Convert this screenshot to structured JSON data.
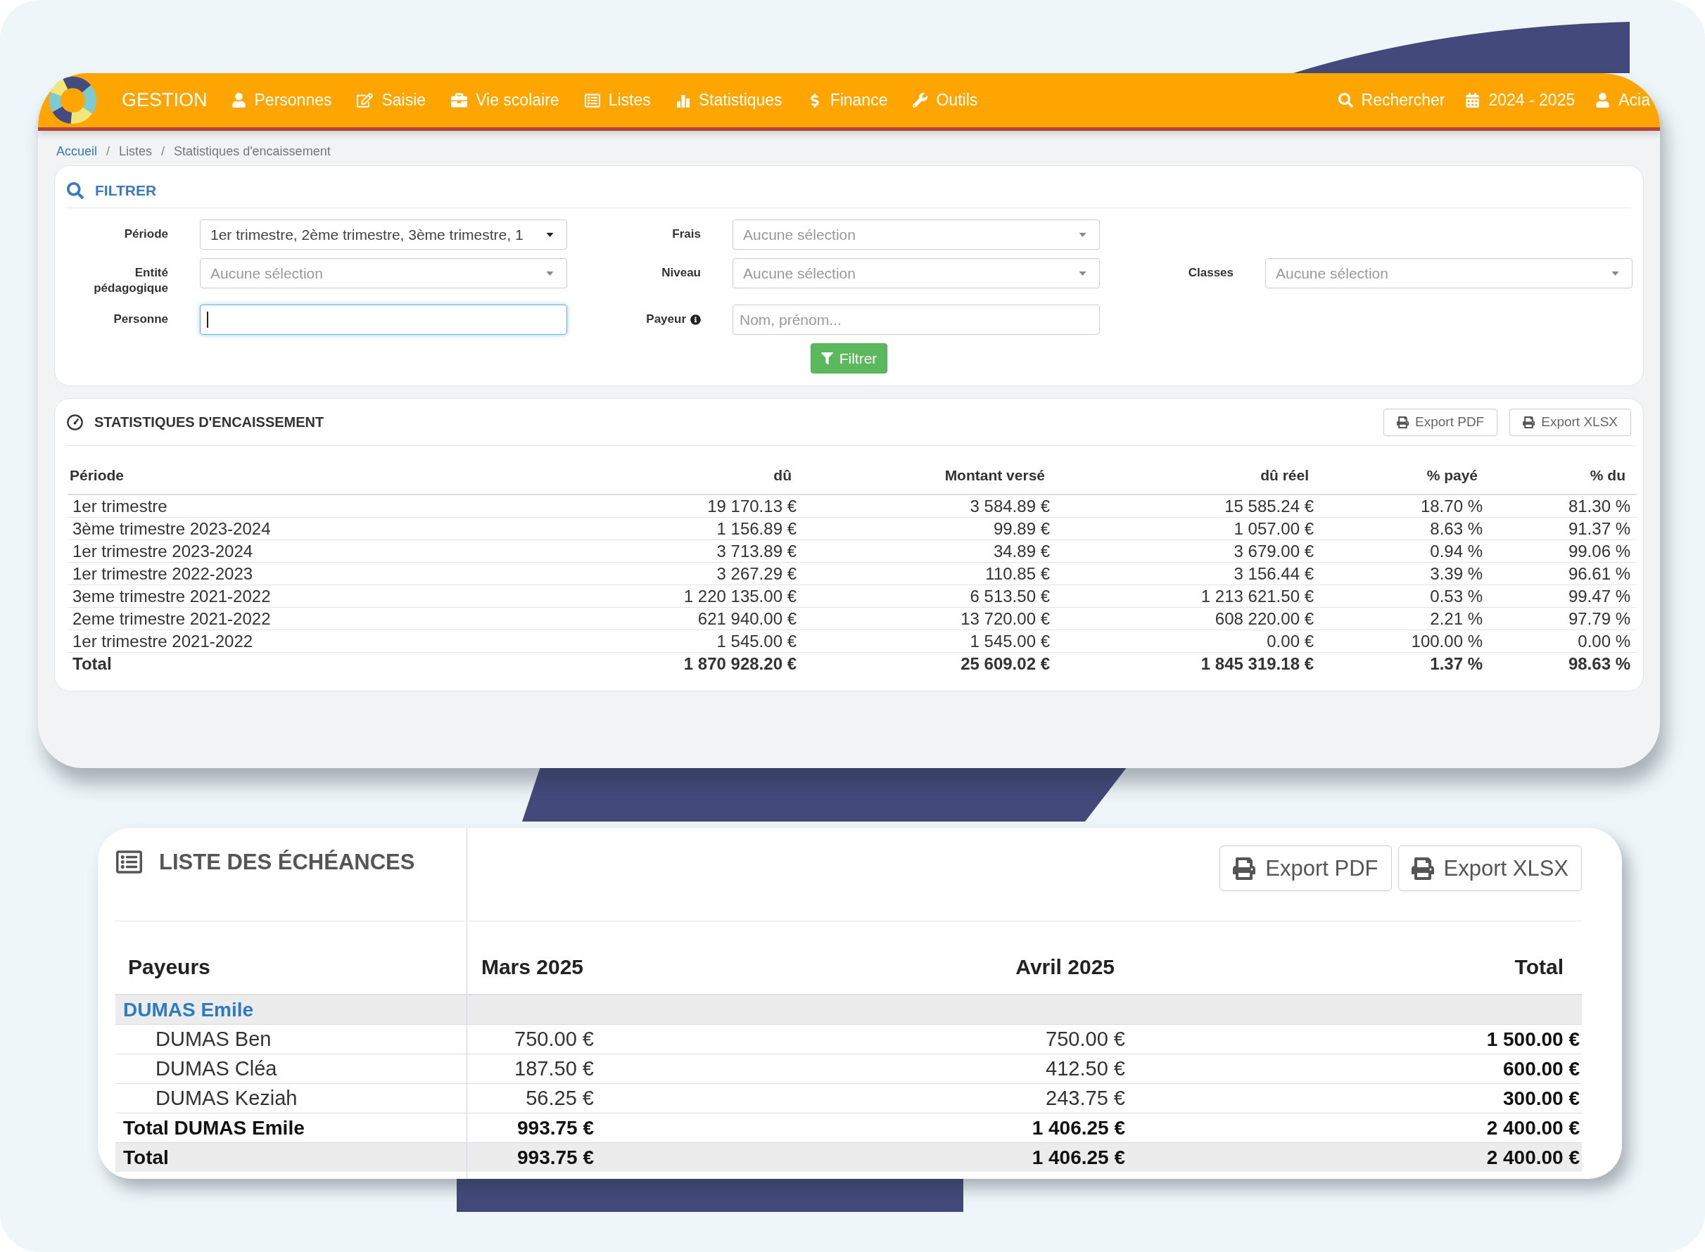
{
  "nav": {
    "brand": "GESTION",
    "items": [
      "Personnes",
      "Saisie",
      "Vie scolaire",
      "Listes",
      "Statistiques",
      "Finance",
      "Outils"
    ],
    "right_items": [
      "Rechercher",
      "2024 - 2025",
      "Acia"
    ]
  },
  "breadcrumb": {
    "items": [
      {
        "label": "Accueil",
        "link": true
      },
      {
        "label": "Listes",
        "link": false
      },
      {
        "label": "Statistiques d'encaissement",
        "link": false
      }
    ],
    "separators": [
      "/",
      "/"
    ]
  },
  "filter": {
    "title": "FILTRER",
    "rows": [
      [
        {
          "label": "Période",
          "kind": "select",
          "value": "1er trimestre, 2ème trimestre, 3ème trimestre, 1",
          "focused": false,
          "info": false
        },
        {
          "label": "Frais",
          "kind": "select",
          "placeholder": "Aucune sélection",
          "focused": false,
          "info": false
        }
      ],
      [
        {
          "label": "Entité pédagogique",
          "kind": "select",
          "placeholder": "Aucune sélection",
          "focused": false,
          "info": false
        },
        {
          "label": "Niveau",
          "kind": "select",
          "placeholder": "Aucune sélection",
          "focused": false,
          "info": false
        },
        {
          "label": "Classes",
          "kind": "select",
          "placeholder": "Aucune sélection",
          "focused": false,
          "info": false
        }
      ],
      [
        {
          "label": "Personne",
          "kind": "text",
          "focused": true,
          "info": false
        },
        {
          "label": "Payeur",
          "kind": "text",
          "placeholder": "Nom, prénom...",
          "focused": false,
          "info": true
        }
      ]
    ],
    "button": "Filtrer"
  },
  "stats": {
    "title": "STATISTIQUES D'ENCAISSEMENT",
    "buttons": [
      "Export PDF",
      "Export XLSX"
    ],
    "columns": [
      "Période",
      "dû",
      "Montant versé",
      "dû réel",
      "% payé",
      "% du"
    ],
    "rows": [
      {
        "kind": "data",
        "cells": [
          "1er trimestre",
          "19 170.13 €",
          "3 584.89 €",
          "15 585.24 €",
          "18.70 %",
          "81.30 %"
        ]
      },
      {
        "kind": "data",
        "cells": [
          "3ème trimestre 2023-2024",
          "1 156.89 €",
          "99.89 €",
          "1 057.00 €",
          "8.63 %",
          "91.37 %"
        ]
      },
      {
        "kind": "data",
        "cells": [
          "1er trimestre 2023-2024",
          "3 713.89 €",
          "34.89 €",
          "3 679.00 €",
          "0.94 %",
          "99.06 %"
        ]
      },
      {
        "kind": "data",
        "cells": [
          "1er trimestre 2022-2023",
          "3 267.29 €",
          "110.85 €",
          "3 156.44 €",
          "3.39 %",
          "96.61 %"
        ]
      },
      {
        "kind": "data",
        "cells": [
          "3eme trimestre 2021-2022",
          "1 220 135.00 €",
          "6 513.50 €",
          "1 213 621.50 €",
          "0.53 %",
          "99.47 %"
        ]
      },
      {
        "kind": "data",
        "cells": [
          "2eme trimestre 2021-2022",
          "621 940.00 €",
          "13 720.00 €",
          "608 220.00 €",
          "2.21 %",
          "97.79 %"
        ]
      },
      {
        "kind": "data",
        "cells": [
          "1er trimestre 2021-2022",
          "1 545.00 €",
          "1 545.00 €",
          "0.00 €",
          "100.00 %",
          "0.00 %"
        ]
      },
      {
        "kind": "total",
        "cells": [
          "Total",
          "1 870 928.20 €",
          "25 609.02 €",
          "1 845 319.18 €",
          "1.37 %",
          "98.63 %"
        ]
      }
    ]
  },
  "echeances": {
    "title": "LISTE DES ÉCHÉANCES",
    "buttons": [
      "Export PDF",
      "Export XLSX"
    ],
    "columns": [
      "Payeurs",
      "Mars 2025",
      "Avril 2025",
      "Total"
    ],
    "rows": [
      {
        "kind": "group",
        "cells": [
          "DUMAS Emile"
        ]
      },
      {
        "kind": "item",
        "cells": [
          "DUMAS Ben",
          "750.00 €",
          "750.00 €",
          "1 500.00 €"
        ]
      },
      {
        "kind": "item",
        "cells": [
          "DUMAS Cléa",
          "187.50 €",
          "412.50 €",
          "600.00 €"
        ]
      },
      {
        "kind": "item",
        "cells": [
          "DUMAS Keziah",
          "56.25 €",
          "243.75 €",
          "300.00 €"
        ]
      },
      {
        "kind": "subtotal",
        "cells": [
          "Total DUMAS Emile",
          "993.75 €",
          "1 406.25 €",
          "2 400.00 €"
        ]
      },
      {
        "kind": "total",
        "cells": [
          "Total",
          "993.75 €",
          "1 406.25 €",
          "2 400.00 €"
        ]
      }
    ]
  }
}
